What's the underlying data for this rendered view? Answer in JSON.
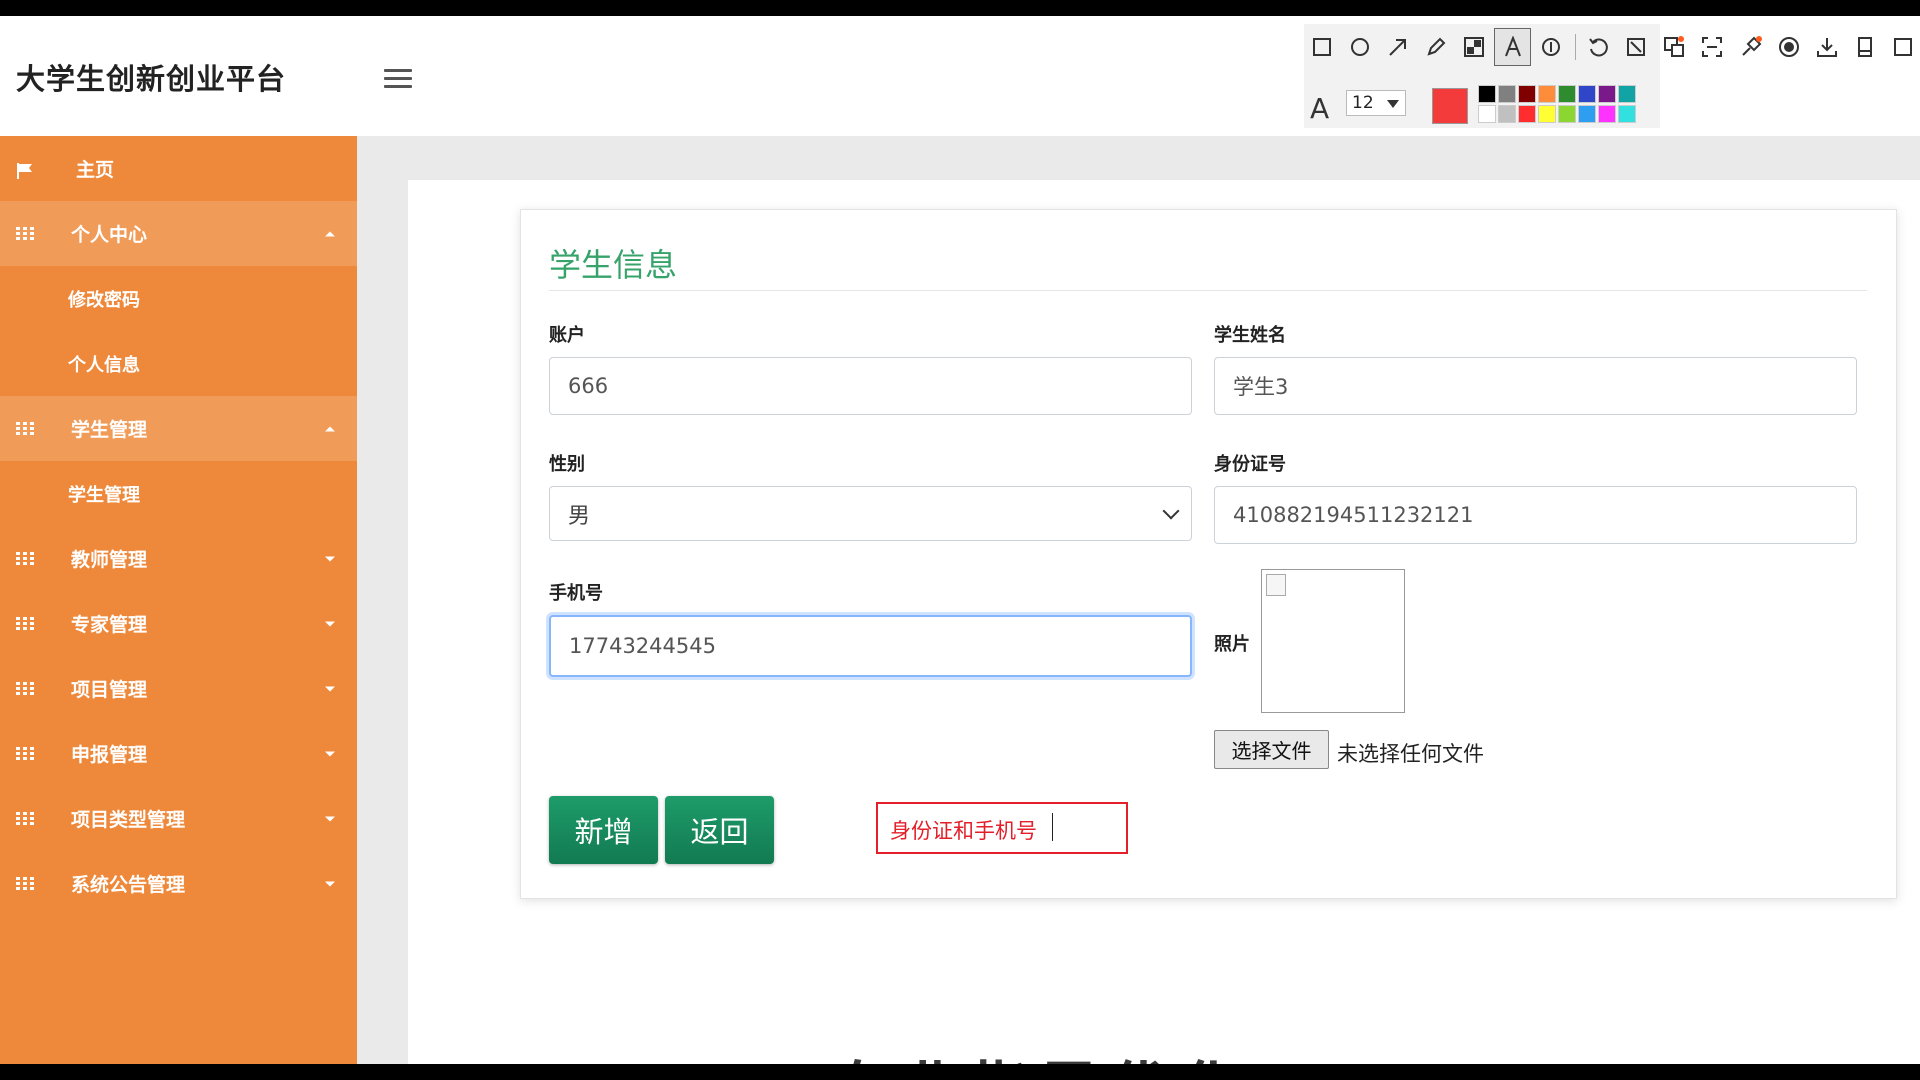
{
  "app": {
    "brand": "大学生创新创业平台"
  },
  "sidebar": {
    "home": "主页",
    "personal_center": {
      "label": "个人中心",
      "children": [
        "修改密码",
        "个人信息"
      ]
    },
    "student_mgmt": {
      "label": "学生管理",
      "children": [
        "学生管理"
      ]
    },
    "teacher_mgmt": "教师管理",
    "expert_mgmt": "专家管理",
    "project_mgmt": "项目管理",
    "declare_mgmt": "申报管理",
    "project_type_mgmt": "项目类型管理",
    "notice_mgmt": "系统公告管理"
  },
  "form": {
    "title": "学生信息",
    "account_label": "账户",
    "account_value": "666",
    "name_label": "学生姓名",
    "name_value": "学生3",
    "gender_label": "性别",
    "gender_value": "男",
    "idcard_label": "身份证号",
    "idcard_value": "410882194511232121",
    "phone_label": "手机号",
    "phone_value": "17743244545",
    "photo_label": "照片",
    "file_button": "选择文件",
    "file_status": "未选择任何文件",
    "add_button": "新增",
    "back_button": "返回"
  },
  "annotation": {
    "text": "身份证和手机号",
    "color": "#e3202a"
  },
  "screenshot_toolbar": {
    "font_size": "12",
    "current_color": "#f43b3b",
    "palette": [
      "#000000",
      "#808080",
      "#800000",
      "#ff8c3a",
      "#2e8b2e",
      "#3046c8",
      "#7a1a8a",
      "#12a4a4",
      "#ffffff",
      "#c0c0c0",
      "#ff2d2d",
      "#ffff33",
      "#8cd632",
      "#2e9ef0",
      "#ff33ff",
      "#33e0e0"
    ],
    "icons": [
      "rectangle-icon",
      "ellipse-icon",
      "arrow-icon",
      "pencil-icon",
      "mosaic-icon",
      "text-icon",
      "number-icon",
      "undo-icon",
      "pin-icon",
      "translate-icon",
      "ocr-icon",
      "pin-top-icon",
      "record-icon",
      "download-icon",
      "save-icon",
      "more-icon"
    ]
  },
  "overlay": {
    "bottom_text": "专业指导优化"
  }
}
